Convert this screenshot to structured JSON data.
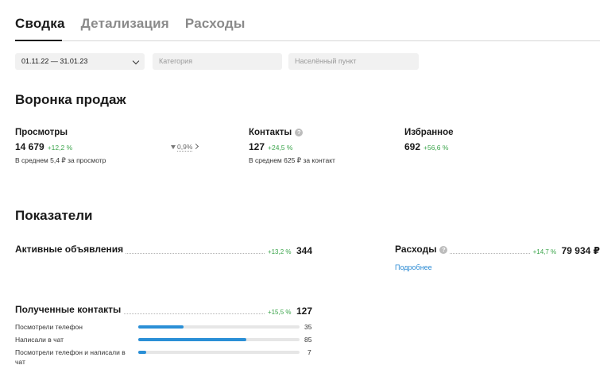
{
  "tabs": [
    {
      "label": "Сводка",
      "active": true
    },
    {
      "label": "Детализация",
      "active": false
    },
    {
      "label": "Расходы",
      "active": false
    }
  ],
  "filters": {
    "date_range": "01.11.22 — 31.01.23",
    "category_placeholder": "Категория",
    "location_placeholder": "Населённый пункт"
  },
  "funnel": {
    "title": "Воронка продаж",
    "views": {
      "label": "Просмотры",
      "value": "14 679",
      "delta": "+12,2 %",
      "note": "В среднем 5,4 ₽ за просмотр"
    },
    "conversion": "0,9%",
    "contacts": {
      "label": "Контакты",
      "value": "127",
      "delta": "+24,5 %",
      "note": "В среднем 625 ₽ за контакт"
    },
    "favorites": {
      "label": "Избранное",
      "value": "692",
      "delta": "+56,6 %"
    }
  },
  "indicators": {
    "title": "Показатели",
    "active_ads": {
      "label": "Активные объявления",
      "delta": "+13,2 %",
      "value": "344"
    },
    "expenses": {
      "label": "Расходы",
      "delta": "+14,7 %",
      "value": "79 934 ₽",
      "link": "Подробнее"
    },
    "contacts_received": {
      "label": "Полученные контакты",
      "delta": "+15,5 %",
      "value": "127",
      "breakdown": [
        {
          "label": "Посмотрели телефон",
          "value": 35,
          "fraction": 0.28
        },
        {
          "label": "Написали в чат",
          "value": 85,
          "fraction": 0.67
        },
        {
          "label": "Посмотрели телефон и написали в чат",
          "value": 7,
          "fraction": 0.05
        }
      ]
    }
  },
  "colors": {
    "accent": "#2a8fd6",
    "positive": "#3aa44a",
    "link": "#2c8bd4"
  }
}
